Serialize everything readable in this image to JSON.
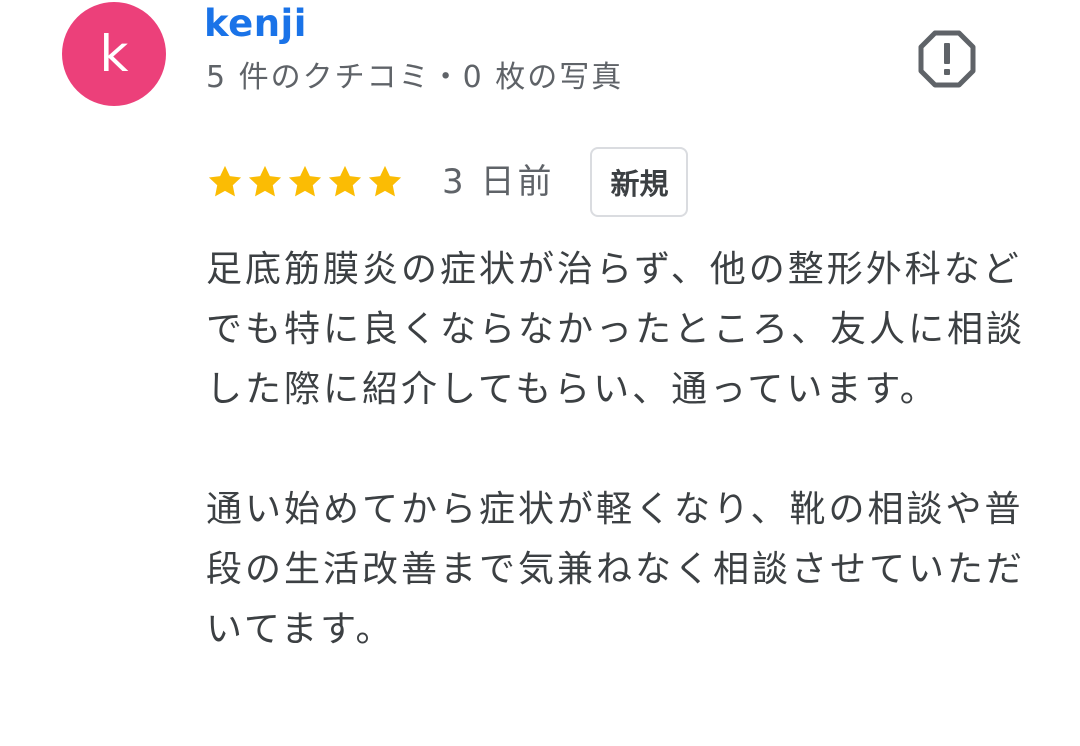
{
  "reviewer": {
    "avatar_initial": "k",
    "avatar_color": "#ec407a",
    "name": "kenji",
    "meta": "5 件のクチコミ・0 枚の写真"
  },
  "review": {
    "rating": 5,
    "max_rating": 5,
    "star_color": "#fbbc04",
    "date": "3 日前",
    "badge": "新規",
    "paragraphs": [
      "足底筋膜炎の症状が治らず、他の整形外科などでも特に良くならなかったところ、友人に相談した際に紹介してもらい、通っています。",
      "通い始めてから症状が軽くなり、靴の相談や普段の生活改善まで気兼ねなく相談させていただいてます。"
    ]
  },
  "icons": {
    "report": "report-flag-icon",
    "star": "star-icon"
  }
}
